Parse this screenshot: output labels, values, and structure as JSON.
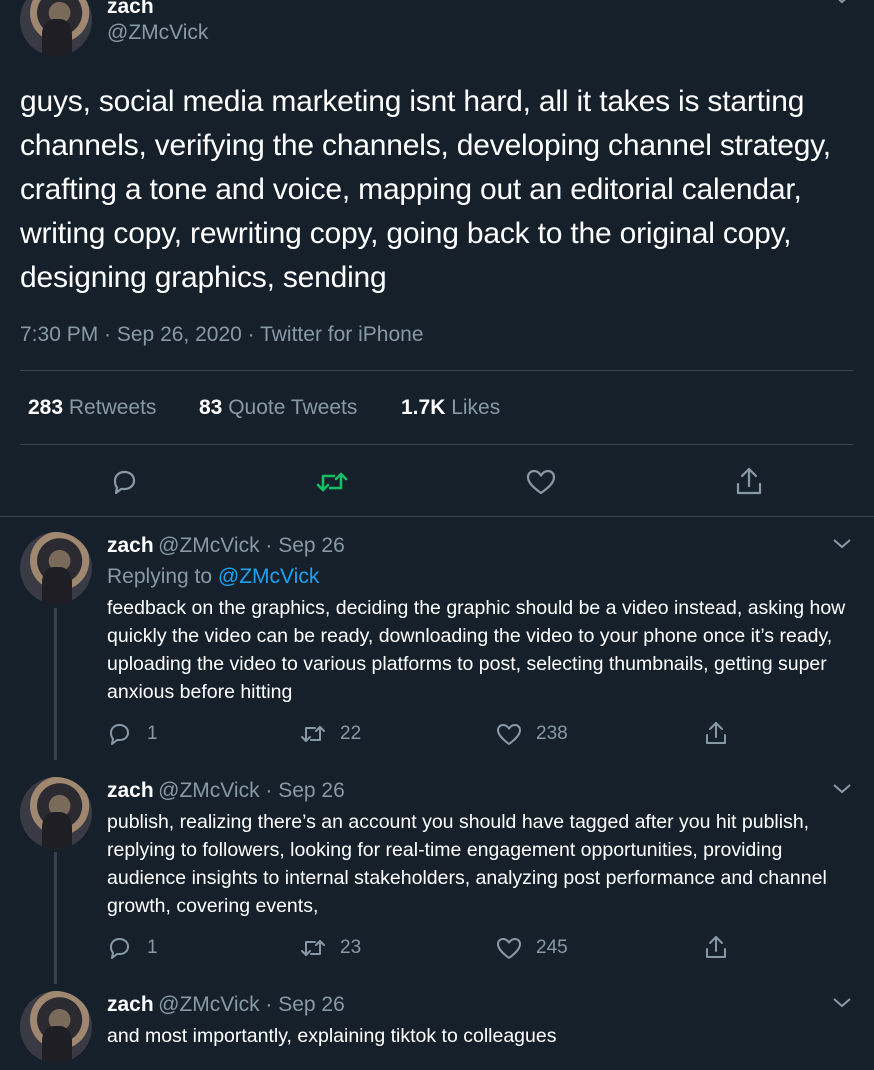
{
  "main_tweet": {
    "name": "zach",
    "handle": "@ZMcVick",
    "text": "guys, social media marketing isnt hard, all it takes is starting channels, verifying the channels, developing channel strategy, crafting a tone and voice, mapping out an editorial calendar, writing copy, rewriting copy, going back to the original copy, designing graphics, sending",
    "meta": "7:30 PM · Sep 26, 2020 · Twitter for iPhone",
    "retweets_count": "283",
    "retweets_label": "Retweets",
    "quotes_count": "83",
    "quotes_label": "Quote Tweets",
    "likes_count": "1.7K",
    "likes_label": "Likes"
  },
  "replies": [
    {
      "name": "zach",
      "handle_date": "@ZMcVick · Sep 26",
      "replying_prefix": "Replying to",
      "replying_handle": "@ZMcVick",
      "text": "feedback on the graphics, deciding the graphic should be a video instead, asking how quickly the video can be ready, downloading the video to your phone once it’s ready, uploading the video to various platforms to post, selecting thumbnails, getting super anxious before hitting",
      "reply_count": "1",
      "retweet_count": "22",
      "like_count": "238"
    },
    {
      "name": "zach",
      "handle_date": "@ZMcVick · Sep 26",
      "text": "publish, realizing there’s an account you should have tagged after you hit publish, replying to followers, looking for real-time engagement opportunities, providing audience insights to internal stakeholders, analyzing post performance and channel growth, covering events,",
      "reply_count": "1",
      "retweet_count": "23",
      "like_count": "245"
    },
    {
      "name": "zach",
      "handle_date": "@ZMcVick · Sep 26",
      "text": "and most importantly, explaining tiktok to colleagues"
    }
  ],
  "colors": {
    "background": "#15202b",
    "accent": "#1da1f2",
    "retweet_green": "#17bf63",
    "secondary_text": "#8899a6",
    "divider": "#38444d"
  },
  "icons": {
    "reply": "reply-icon",
    "retweet": "retweet-icon",
    "like": "heart-icon",
    "share": "share-icon",
    "more": "chevron-down-icon"
  }
}
